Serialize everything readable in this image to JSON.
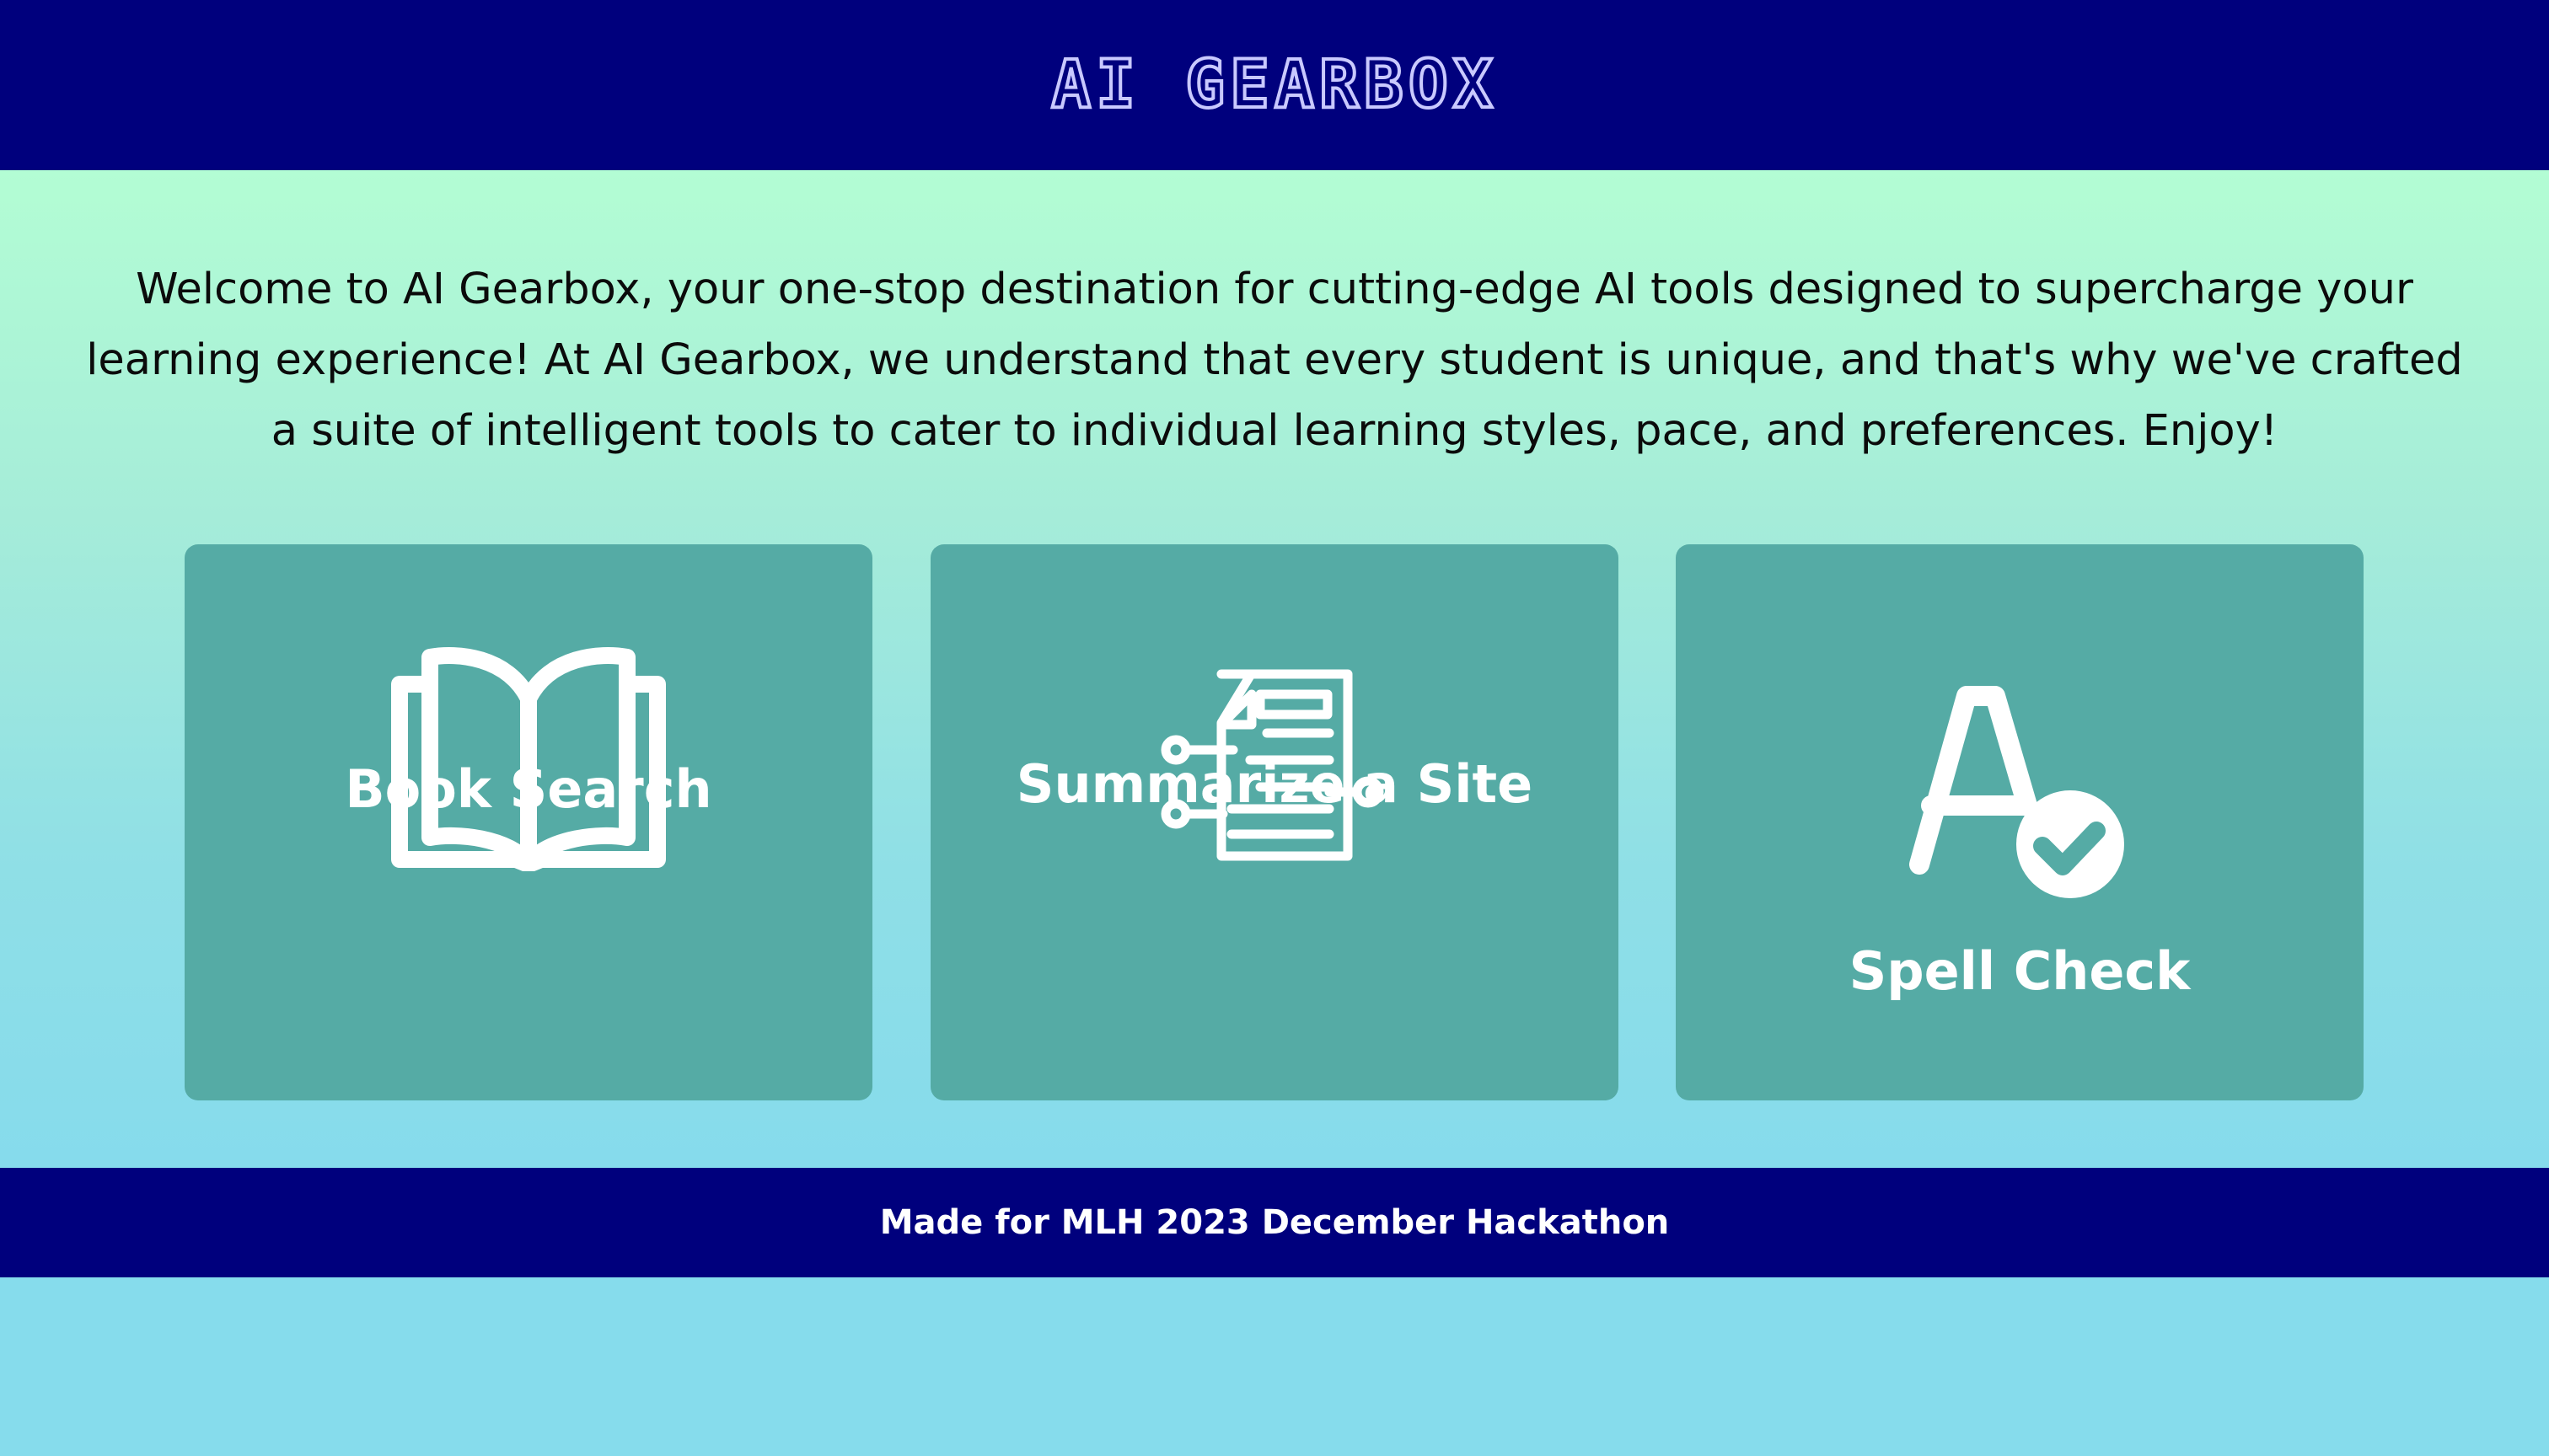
{
  "header": {
    "title": "AI GEARBOX"
  },
  "intro": {
    "text": "Welcome to AI Gearbox, your one-stop destination for cutting-edge AI tools designed to supercharge your learning experience! At AI Gearbox, we understand that every student is unique, and that's why we've crafted a suite of intelligent tools to cater to individual learning styles, pace, and preferences. Enjoy!"
  },
  "tools": [
    {
      "label": "Book Search",
      "icon": "open-book-icon"
    },
    {
      "label": "Summarize a Site",
      "icon": "document-summary-icon"
    },
    {
      "label": "Spell Check",
      "icon": "spell-check-icon"
    }
  ],
  "footer": {
    "text": "Made for MLH 2023 December Hackathon"
  },
  "colors": {
    "header_bg": "#00007d",
    "card_bg": "#55aba5",
    "gradient_top": "#b3fdd4",
    "gradient_bottom": "#86dbec"
  }
}
